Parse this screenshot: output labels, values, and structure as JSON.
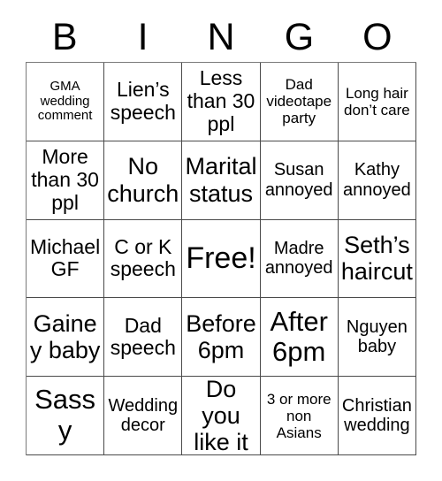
{
  "card": {
    "header_letters": [
      "B",
      "I",
      "N",
      "G",
      "O"
    ],
    "background_color": "#ffffff",
    "text_color": "#000000",
    "border_color": "#4a4a4a",
    "rows": 5,
    "columns": 5,
    "cells": [
      {
        "text": "GMA wedding comment",
        "size": "xs"
      },
      {
        "text": "Lien’s speech",
        "size": "lg"
      },
      {
        "text": "Less than 30 ppl",
        "size": "lg"
      },
      {
        "text": "Dad videotape party",
        "size": "sm"
      },
      {
        "text": "Long hair don’t care",
        "size": "sm"
      },
      {
        "text": "More than 30 ppl",
        "size": "lg"
      },
      {
        "text": "No church",
        "size": "xl"
      },
      {
        "text": "Marital status",
        "size": "xl"
      },
      {
        "text": "Susan annoyed",
        "size": "md"
      },
      {
        "text": "Kathy annoyed",
        "size": "md"
      },
      {
        "text": "Michael GF",
        "size": "lg"
      },
      {
        "text": "C or K speech",
        "size": "lg"
      },
      {
        "text": "Free!",
        "size": "huge"
      },
      {
        "text": "Madre annoyed",
        "size": "md"
      },
      {
        "text": "Seth’s haircut",
        "size": "xl"
      },
      {
        "text": "Gainey baby",
        "size": "xl"
      },
      {
        "text": "Dad speech",
        "size": "lg"
      },
      {
        "text": "Before 6pm",
        "size": "xl"
      },
      {
        "text": "After 6pm",
        "size": "xxl"
      },
      {
        "text": "Nguyen baby",
        "size": "md"
      },
      {
        "text": "Sassy",
        "size": "xxl"
      },
      {
        "text": "Wedding decor",
        "size": "md"
      },
      {
        "text": "Do you like it",
        "size": "xl"
      },
      {
        "text": "3 or more non Asians",
        "size": "sm"
      },
      {
        "text": "Christian wedding",
        "size": "md"
      }
    ]
  }
}
